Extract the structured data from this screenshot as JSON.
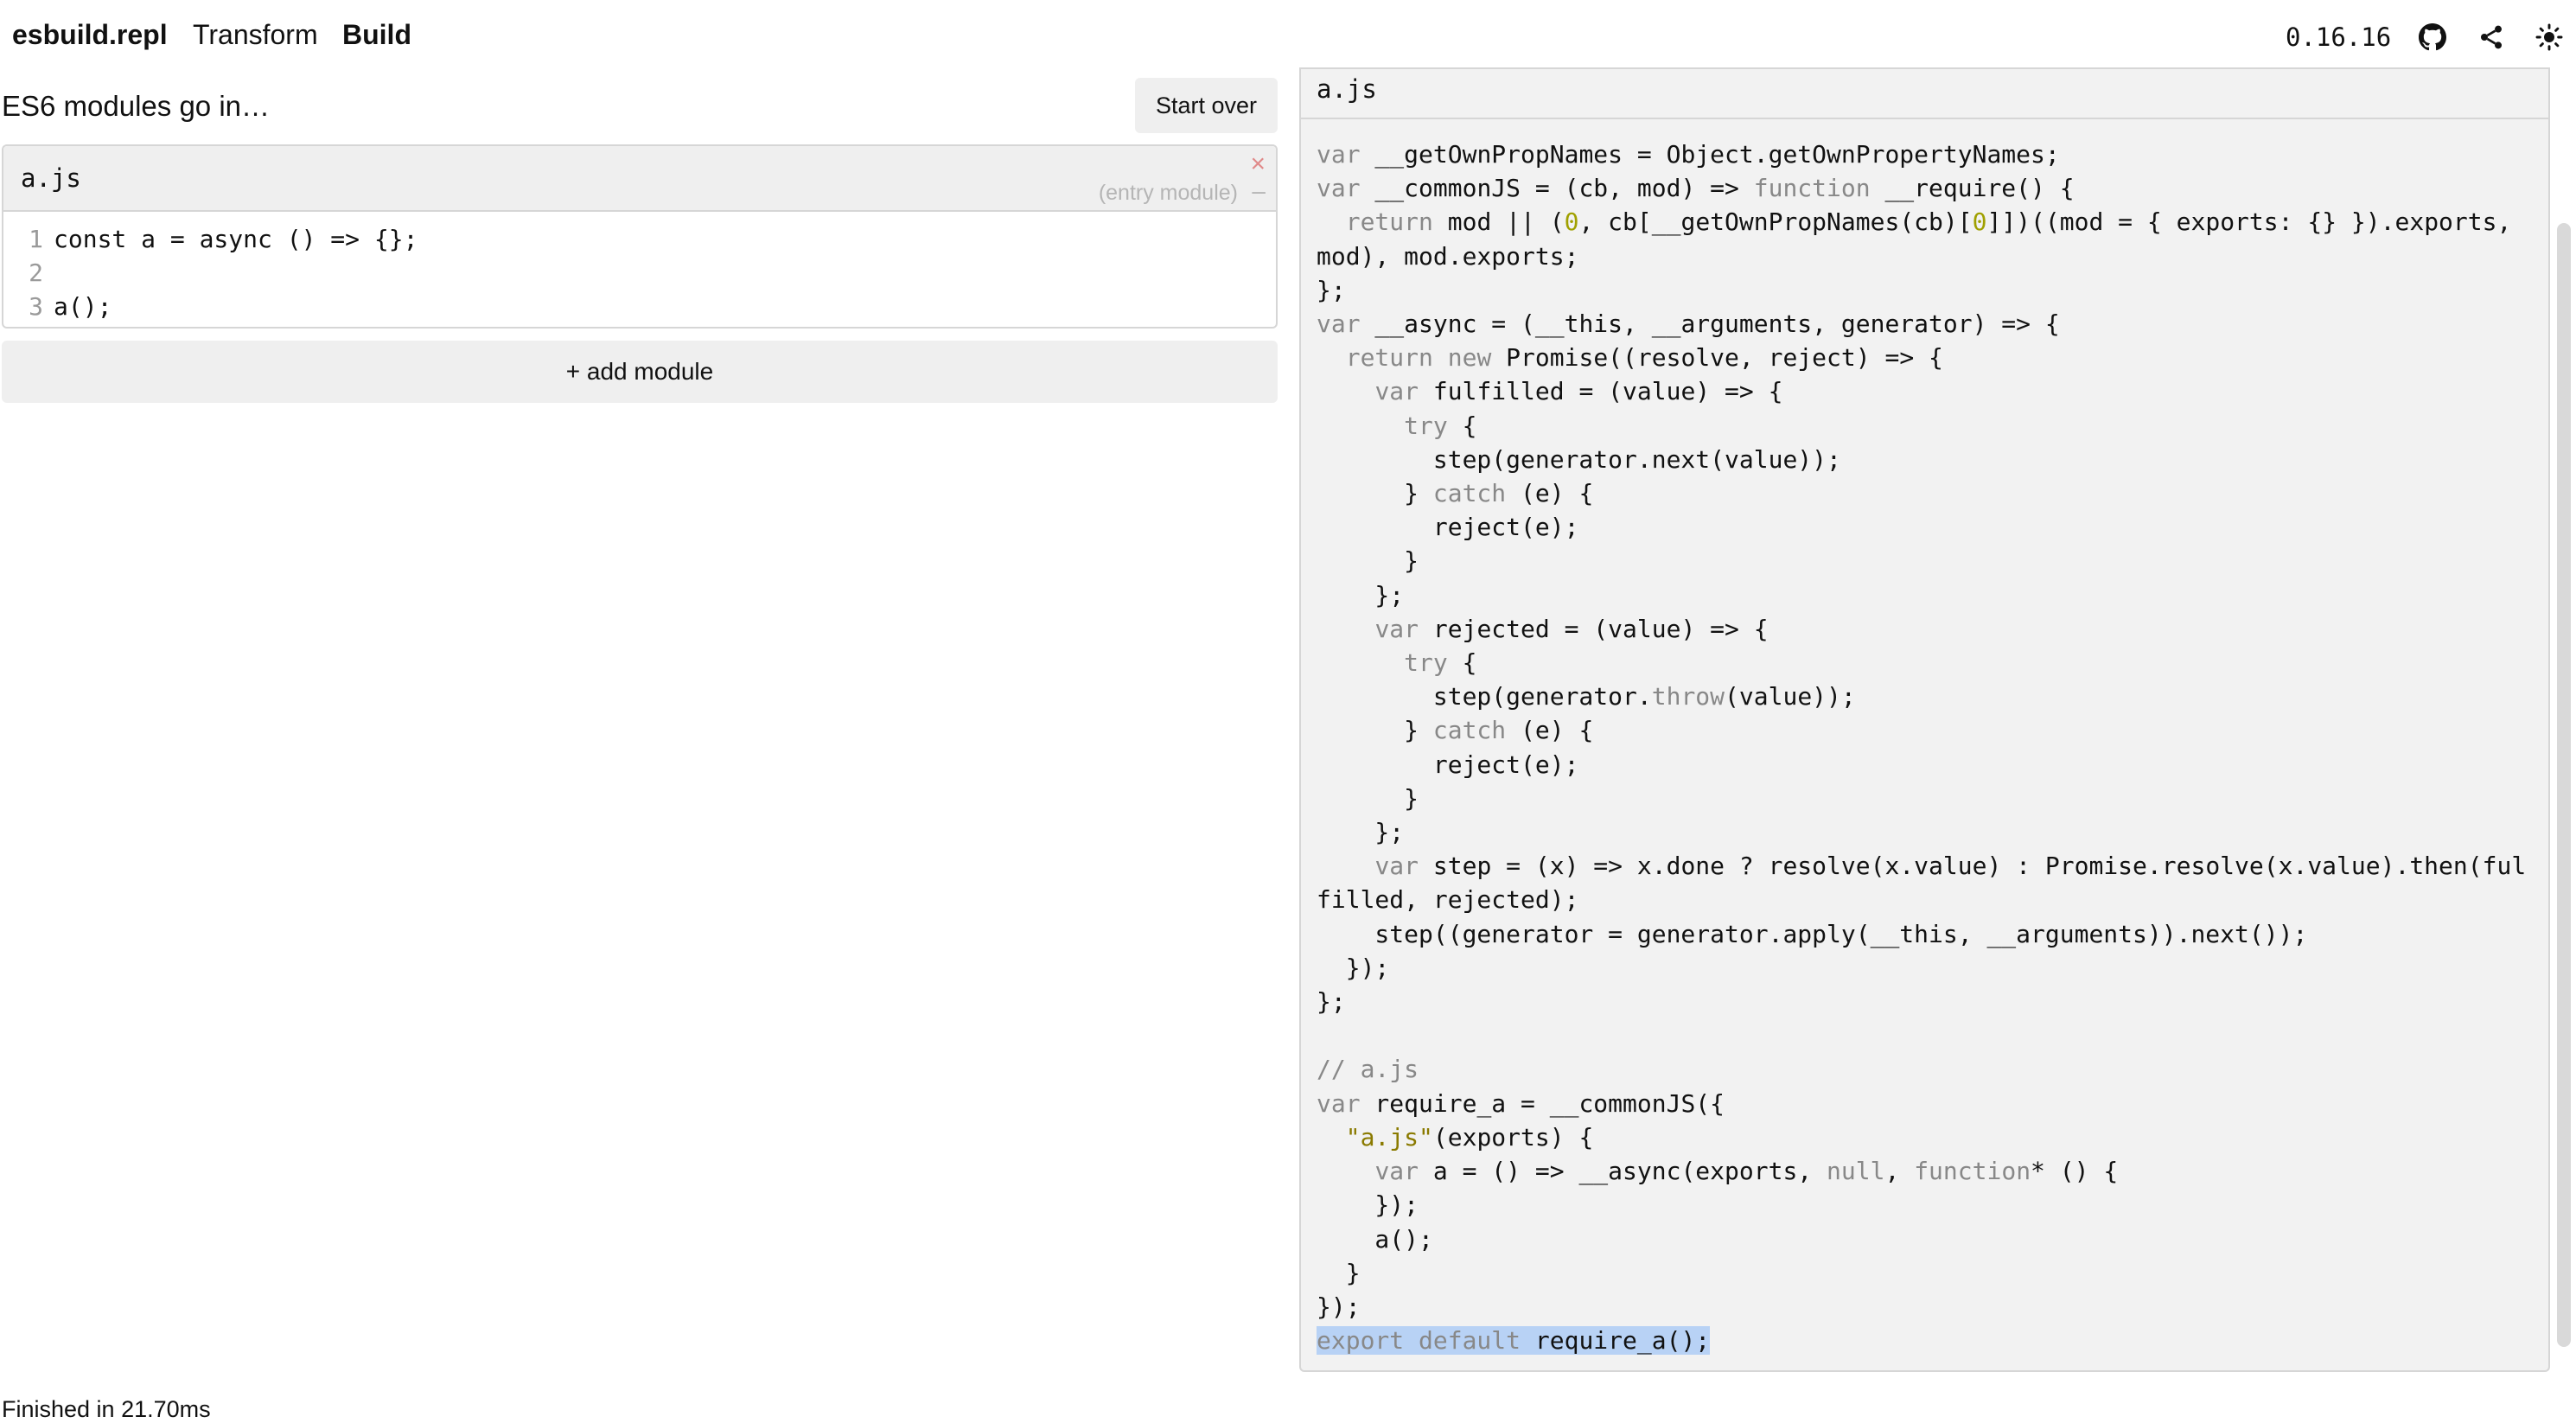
{
  "nav": {
    "brand": "esbuild.repl",
    "transform": "Transform",
    "build": "Build",
    "version": "0.16.16",
    "icons": [
      "github-icon",
      "share-icon",
      "theme-sun-icon"
    ]
  },
  "left": {
    "title": "ES6 modules go in…",
    "start_over": "Start over",
    "module": {
      "name": "a.js",
      "close": "×",
      "entry_label": "(entry module)",
      "collapse": "–",
      "lines": [
        {
          "no": "1",
          "code": "const a = async () => {};"
        },
        {
          "no": "2",
          "code": ""
        },
        {
          "no": "3",
          "code": "a();"
        }
      ]
    },
    "add_module": "+ add module",
    "status": "Finished in 21.70ms"
  },
  "output": {
    "file": "a.js",
    "code_lines": [
      "var __getOwnPropNames = Object.getOwnPropertyNames;",
      "var __commonJS = (cb, mod) => function __require() {",
      "  return mod || (0, cb[__getOwnPropNames(cb)[0]])((mod = { exports: {} }).exports,",
      "mod), mod.exports;",
      "};",
      "var __async = (__this, __arguments, generator) => {",
      "  return new Promise((resolve, reject) => {",
      "    var fulfilled = (value) => {",
      "      try {",
      "        step(generator.next(value));",
      "      } catch (e) {",
      "        reject(e);",
      "      }",
      "    };",
      "    var rejected = (value) => {",
      "      try {",
      "        step(generator.throw(value));",
      "      } catch (e) {",
      "        reject(e);",
      "      }",
      "    };",
      "    var step = (x) => x.done ? resolve(x.value) : Promise.resolve(x.value).then(ful",
      "filled, rejected);",
      "    step((generator = generator.apply(__this, __arguments)).next());",
      "  });",
      "};",
      "",
      "// a.js",
      "var require_a = __commonJS({",
      "  \"a.js\"(exports) {",
      "    var a = () => __async(exports, null, function* () {",
      "    });",
      "    a();",
      "  }",
      "});",
      "export default require_a();"
    ]
  }
}
